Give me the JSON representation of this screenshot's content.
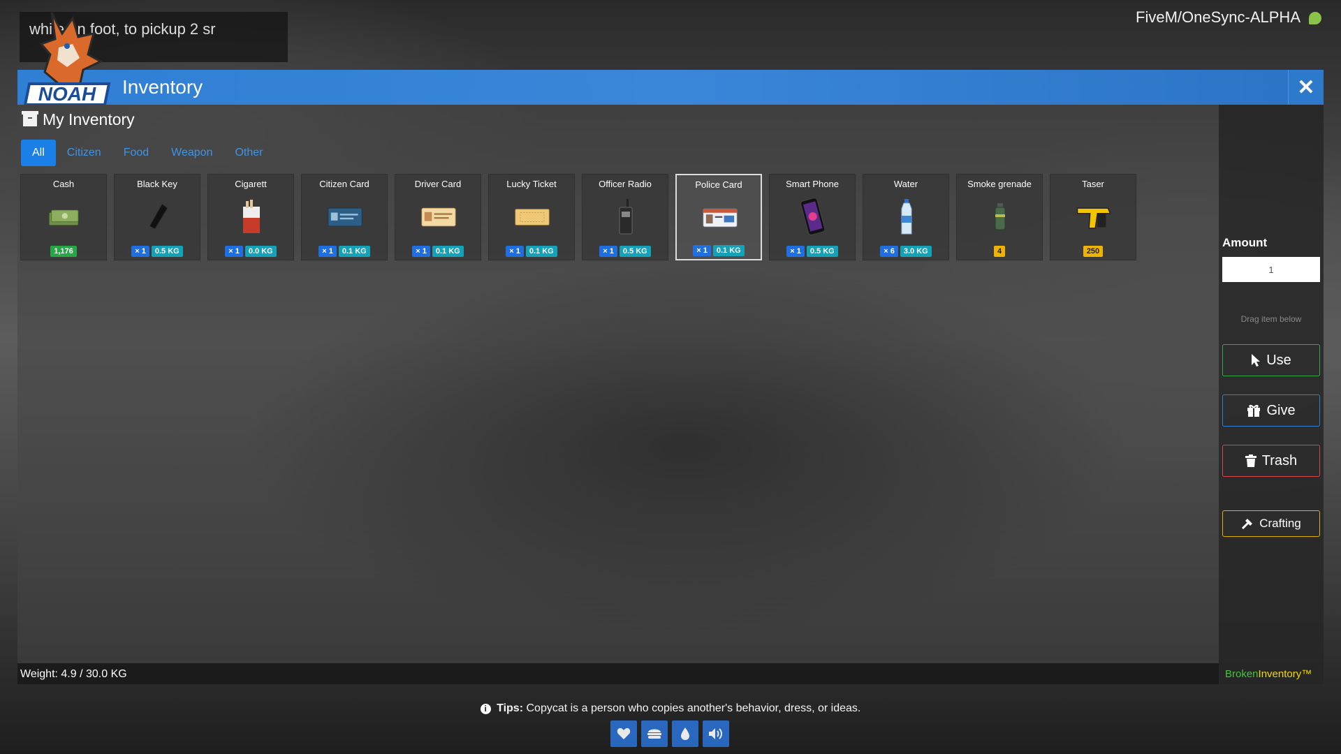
{
  "notification": {
    "text": "while on foot, to pickup 2 sr"
  },
  "server": {
    "title": "FiveM/OneSync-ALPHA"
  },
  "logo": {
    "text": "NOAH"
  },
  "header": {
    "title": "Inventory"
  },
  "inventory": {
    "title": "My Inventory",
    "tabs": [
      {
        "label": "All",
        "active": true
      },
      {
        "label": "Citizen",
        "active": false
      },
      {
        "label": "Food",
        "active": false
      },
      {
        "label": "Weapon",
        "active": false
      },
      {
        "label": "Other",
        "active": false
      }
    ],
    "items": [
      {
        "name": "Cash",
        "badges": [
          {
            "type": "cash",
            "text": "1,176"
          }
        ],
        "icon": "cash-stack-icon",
        "selected": false
      },
      {
        "name": "Black Key",
        "badges": [
          {
            "type": "count",
            "text": "× 1"
          },
          {
            "type": "weight",
            "text": "0.5 KG"
          }
        ],
        "icon": "key-icon",
        "selected": false
      },
      {
        "name": "Cigarett",
        "badges": [
          {
            "type": "count",
            "text": "× 1"
          },
          {
            "type": "weight",
            "text": "0.0 KG"
          }
        ],
        "icon": "cigarette-pack-icon",
        "selected": false
      },
      {
        "name": "Citizen Card",
        "badges": [
          {
            "type": "count",
            "text": "× 1"
          },
          {
            "type": "weight",
            "text": "0.1 KG"
          }
        ],
        "icon": "citizen-card-icon",
        "selected": false
      },
      {
        "name": "Driver Card",
        "badges": [
          {
            "type": "count",
            "text": "× 1"
          },
          {
            "type": "weight",
            "text": "0.1 KG"
          }
        ],
        "icon": "driver-card-icon",
        "selected": false
      },
      {
        "name": "Lucky Ticket",
        "badges": [
          {
            "type": "count",
            "text": "× 1"
          },
          {
            "type": "weight",
            "text": "0.1 KG"
          }
        ],
        "icon": "ticket-icon",
        "selected": false
      },
      {
        "name": "Officer Radio",
        "badges": [
          {
            "type": "count",
            "text": "× 1"
          },
          {
            "type": "weight",
            "text": "0.5 KG"
          }
        ],
        "icon": "radio-icon",
        "selected": false
      },
      {
        "name": "Police Card",
        "badges": [
          {
            "type": "count",
            "text": "× 1"
          },
          {
            "type": "weight",
            "text": "0.1 KG"
          }
        ],
        "icon": "police-card-icon",
        "selected": true
      },
      {
        "name": "Smart Phone",
        "badges": [
          {
            "type": "count",
            "text": "× 1"
          },
          {
            "type": "weight",
            "text": "0.5 KG"
          }
        ],
        "icon": "phone-icon",
        "selected": false
      },
      {
        "name": "Water",
        "badges": [
          {
            "type": "count",
            "text": "× 6"
          },
          {
            "type": "weight",
            "text": "3.0 KG"
          }
        ],
        "icon": "water-bottle-icon",
        "selected": false
      },
      {
        "name": "Smoke grenade",
        "badges": [
          {
            "type": "ammo",
            "text": "4"
          }
        ],
        "icon": "grenade-icon",
        "selected": false
      },
      {
        "name": "Taser",
        "badges": [
          {
            "type": "ammo",
            "text": "250"
          }
        ],
        "icon": "taser-icon",
        "selected": false
      }
    ],
    "weight_text": "Weight: 4.9 / 30.0 KG"
  },
  "side": {
    "amount_label": "Amount",
    "amount_value": "1",
    "drag_hint": "Drag item below",
    "use_label": "Use",
    "give_label": "Give",
    "trash_label": "Trash",
    "crafting_label": "Crafting",
    "brand_part1": "Broken",
    "brand_part2": "Inventory™"
  },
  "tips": {
    "label": "Tips:",
    "text": "Copycat is a person who copies another's behavior, dress, or ideas."
  },
  "status_icons": [
    "heart-icon",
    "burger-icon",
    "drop-icon",
    "speaker-icon"
  ],
  "colors": {
    "accent": "#2f7fd4",
    "use": "#3aa64a",
    "give": "#2d7fd4",
    "trash": "#d9434a",
    "craft": "#e2b100"
  }
}
